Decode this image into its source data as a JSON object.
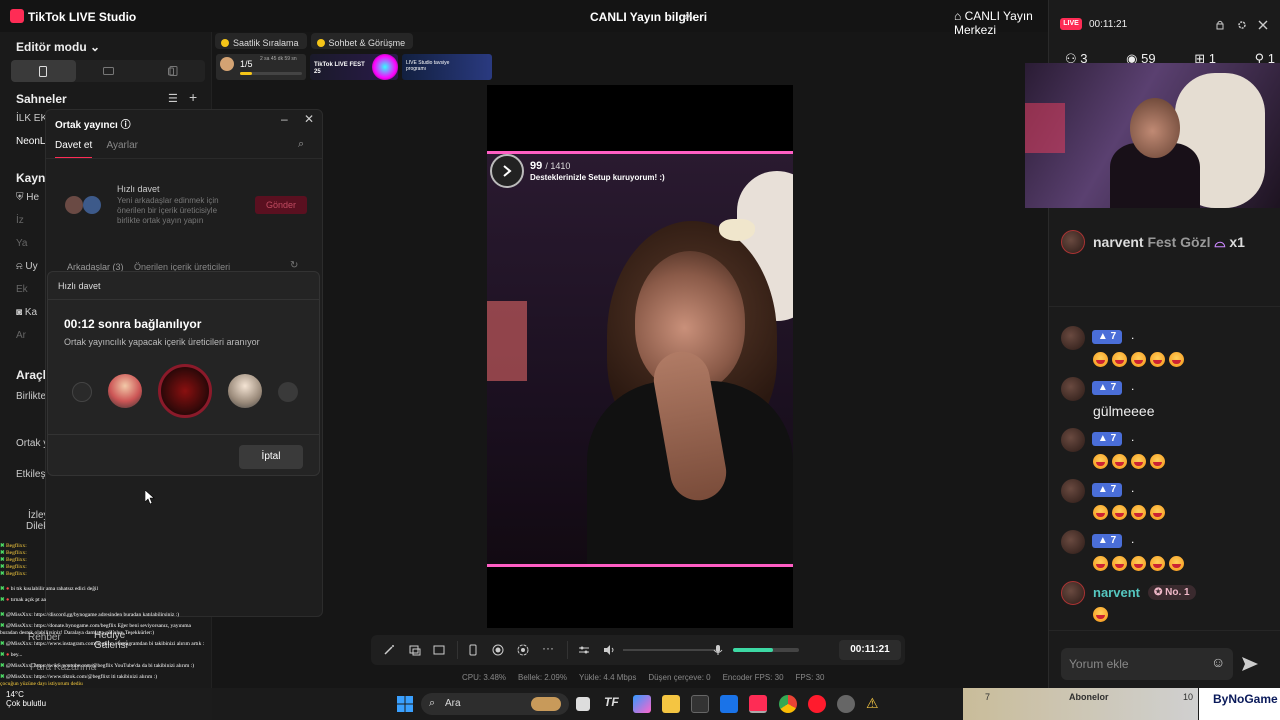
{
  "app": {
    "title": "TikTok LIVE Studio",
    "center_title": "CANLI Yayın bilgileri",
    "live_center": "CANLI Yayın Merkezi"
  },
  "sidebar": {
    "editor_mode": "Editör modu",
    "scenes": "Sahneler",
    "scene_first": "İLK EK",
    "scene_neon": "NeonL",
    "sources": "Kaynak",
    "source_items": [
      "He",
      "İz",
      "Ya",
      "Uy",
      "Ek",
      "Ka",
      "Ar"
    ],
    "tools": "Araçla",
    "together": "Birlikte",
    "ortak_short": "Ortak y",
    "interaction": "Etkileş",
    "viewer": "İzley",
    "dilek": "Dilek",
    "hediye": "Hediye",
    "galerisi": "Galerisi",
    "rehber": "Rehber",
    "para": "Para Kazanma"
  },
  "ortak_dialog": {
    "title": "Ortak yayıncı",
    "tab_invite": "Davet et",
    "tab_settings": "Ayarlar",
    "quick_title": "Hızlı davet",
    "quick_desc": "Yeni arkadaşlar edinmek için önerilen bir içerik üreticisiyle birlikte ortak yayın yapın",
    "send_button": "Gönder",
    "friends_tab": "Arkadaşlar (3)",
    "suggested_tab": "Önerilen içerik üreticileri"
  },
  "quick_modal": {
    "header": "Hızlı davet",
    "countdown": "00:12 sonra bağlanılıyor",
    "searching": "Ortak yayıncılık yapacak içerik üreticileri aranıyor",
    "cancel_button": "İptal"
  },
  "top_strip": {
    "hourly_rank": "Saatlik Sıralama",
    "chat_meet": "Sohbet & Görüşme",
    "goal_progress": "1/5",
    "goal_timer": "2 sa 45 dk 59 sn",
    "banner_fest": "TikTok LIVE FEST 25",
    "banner_studio": "LIVE Studio tavsiye programı"
  },
  "preview": {
    "goal_value": "99",
    "goal_target": "/ 1410",
    "goal_text": "Desteklerinizle Setup kuruyorum! :)"
  },
  "toolbar": {
    "timer": "00:11:21",
    "mic_level": 0.6
  },
  "status_bar": {
    "cpu": "CPU: 3.48%",
    "memory": "Bellek: 2.09%",
    "upload": "Yükle: 4.4 Mbps",
    "dropped": "Düşen çerçeve: 0",
    "encoder_fps": "Encoder FPS: 30",
    "fps": "FPS: 30"
  },
  "chat_panel": {
    "live_label": "LIVE",
    "live_time": "00:11:21",
    "stat_users": "3",
    "stat_views": "59",
    "stat_gifts": "1",
    "stat_follows": "1",
    "top_gift_user": "narvent",
    "top_gift_text": "Fest Gözl",
    "top_gift_count": "x1",
    "level": "7",
    "msg_gulmeee": "gülmeeee",
    "narvent_name": "narvent",
    "narvent_badge": "No. 1",
    "comment_placeholder": "Yorum ekle"
  },
  "overlay_chat": [
    "Begflixx: ",
    "Begflixx: ",
    "Begflixx: ",
    "Begflixx: ",
    "Begflixx: ",
    "bi tık kısılabilir ama rahatsız edici değil",
    "tırnak açık pt aa",
    "@MissXxx: https://discord.gg/bynogame adresinden buradan katılabilirsiniz :)",
    "@MissXxx: https://donate.bynogame.com/begflix Eğer beni seviyorsanız, yayınıma",
    "buradan destek olabilirsiniz! Daralaya damlaya göl olur. Teşekkürler:)",
    "@MissXxx: https://www.instagram.com/begflix_/ Instagramdan bi takibinizi alırım artık :",
    "bey...",
    "@MissXxx: https://www.youtube.com/@begflix YouTube'da da bi takibinizi alırım :)",
    "@MissXxx: https://www.tiktok.com/@begflixt iti takibinizi alırım :)",
    "çocuğun yüzüne dayı istiyorum dediu"
  ],
  "taskbar": {
    "search_placeholder": "Ara",
    "weather": "14°C",
    "weather_desc": "Çok bulutlu",
    "tray_label": "Abonelor",
    "tray_num_left": "7",
    "tray_num_right": "10",
    "brand": "ByNoGame"
  },
  "colors": {
    "accent": "#fe2c55",
    "teal": "#55c7c0",
    "level": "#4a6ed8",
    "mic": "#3dd9a4",
    "overlay_bar": "#ff5ec4"
  }
}
